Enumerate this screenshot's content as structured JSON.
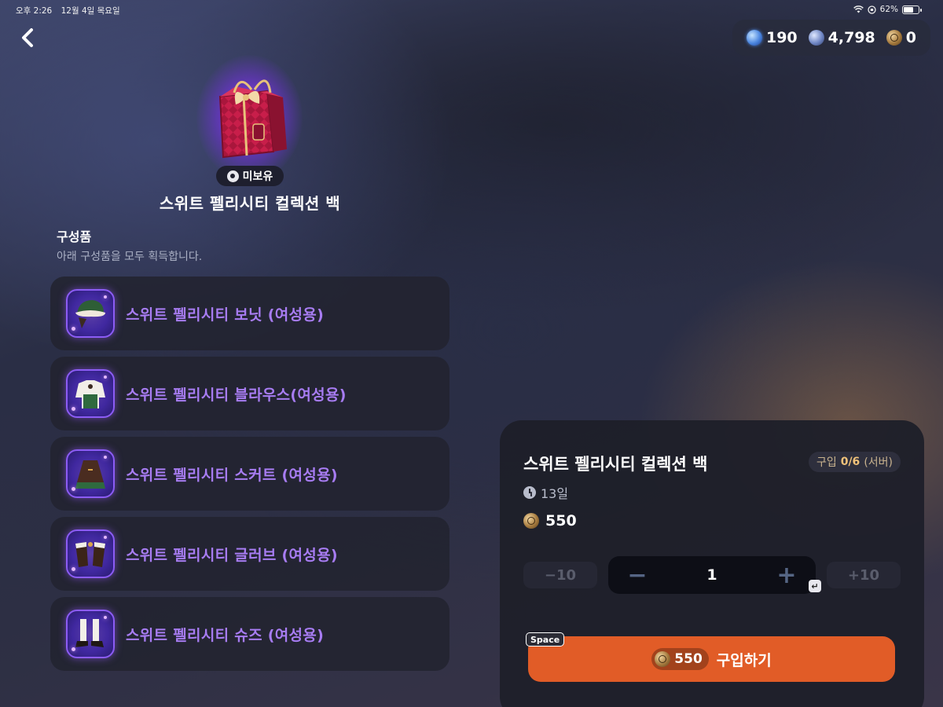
{
  "status_bar": {
    "time": "오후 2:26",
    "date": "12월 4일 목요일",
    "battery": "62%"
  },
  "currency": {
    "items": [
      {
        "icon": "blue-gem-icon",
        "value": "190",
        "color": "#4b86e0"
      },
      {
        "icon": "steel-coin-icon",
        "value": "4,798",
        "color": "#6f86c4"
      },
      {
        "icon": "bronze-coin-icon",
        "value": "0",
        "color": "#a57a3e"
      }
    ]
  },
  "item": {
    "owned_badge": "미보유",
    "title": "스위트 펠리시티 컬렉션 백"
  },
  "components": {
    "title": "구성품",
    "description": "아래 구성품을 모두 획득합니다.",
    "items": [
      {
        "name": "스위트 펠리시티 보닛 (여성용)",
        "icon": "bonnet-icon"
      },
      {
        "name": "스위트 펠리시티 블라우스(여성용)",
        "icon": "blouse-icon"
      },
      {
        "name": "스위트 펠리시티 스커트 (여성용)",
        "icon": "skirt-icon"
      },
      {
        "name": "스위트 펠리시티 글러브 (여성용)",
        "icon": "glove-icon"
      },
      {
        "name": "스위트 펠리시티 슈즈 (여성용)",
        "icon": "shoes-icon"
      }
    ]
  },
  "purchase": {
    "title": "스위트 펠리시티 컬렉션 백",
    "limit_label": "구입",
    "limit_value": "0/6",
    "limit_scope": "(서버)",
    "time_left": "13일",
    "price": "550",
    "minus10": "−10",
    "plus10": "+10",
    "minus": "−",
    "plus": "+",
    "quantity": "1",
    "enter_key": "↵",
    "space_key": "Space",
    "buy_price": "550",
    "buy_label": "구입하기",
    "accent_color": "#e15c27"
  }
}
